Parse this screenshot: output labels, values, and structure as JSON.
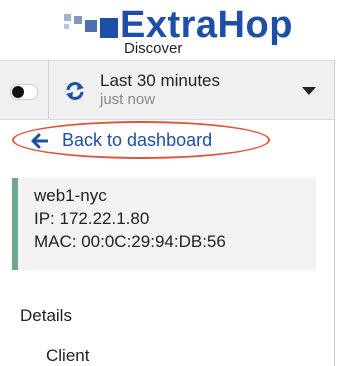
{
  "brand": {
    "name": "ExtraHop",
    "product": "Discover",
    "color": "#1e4fa8"
  },
  "toolbar": {
    "time_range": "Last 30 minutes",
    "refreshed": "just now",
    "icons": [
      "toggle-switch",
      "refresh-icon",
      "caret-down-icon"
    ]
  },
  "nav": {
    "back_label": "Back to dashboard",
    "highlight_color": "#e0553f"
  },
  "device": {
    "name": "web1-nyc",
    "ip": "IP: 172.22.1.80",
    "mac": "MAC: 00:0C:29:94:DB:56",
    "accent_color": "#6fa88c"
  },
  "sections": {
    "details": "Details",
    "client": "Client"
  }
}
